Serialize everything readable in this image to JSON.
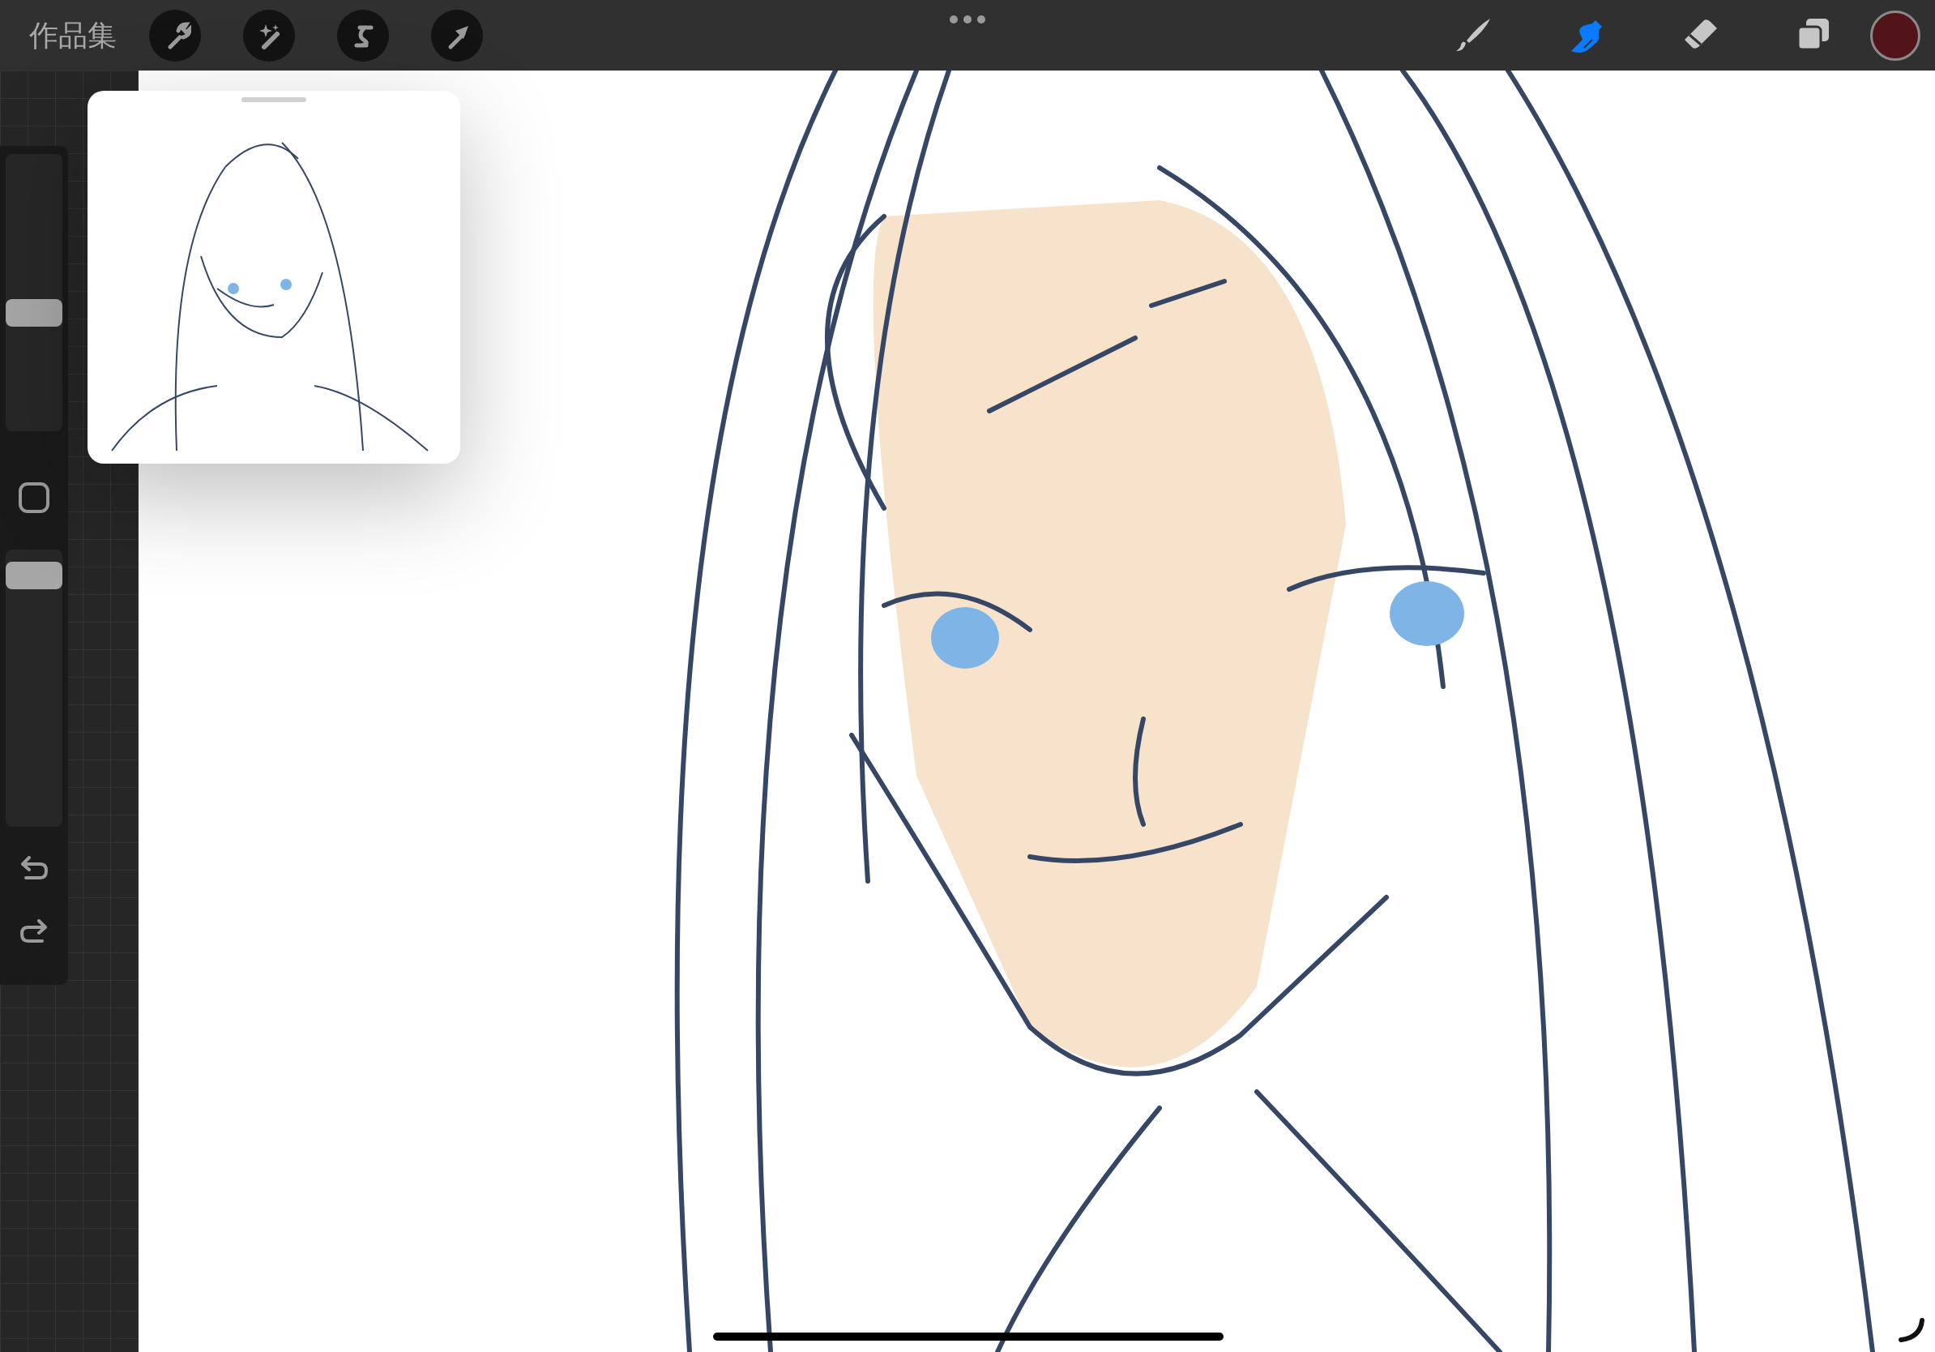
{
  "top_bar": {
    "gallery_label": "作品集",
    "left_tools": [
      {
        "kind": "wrench"
      },
      {
        "kind": "wand"
      },
      {
        "kind": "selection"
      },
      {
        "kind": "transform"
      }
    ],
    "right_tools": [
      {
        "kind": "brush",
        "selected": false
      },
      {
        "kind": "smudge",
        "selected": true
      },
      {
        "kind": "eraser",
        "selected": false
      },
      {
        "kind": "layers",
        "selected": false
      }
    ],
    "current_color": {
      "color": "#521418"
    }
  },
  "sidebar": {
    "size_slider": {
      "level": 0.42
    },
    "opacity_slider": {
      "level": 0.95
    }
  },
  "reference": {
    "visible": true
  }
}
